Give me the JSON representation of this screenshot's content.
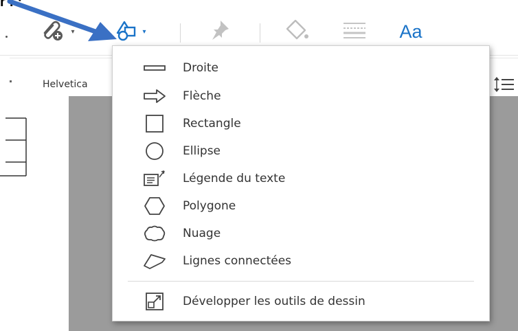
{
  "top_fragment": "r : :",
  "toolbar": {
    "items": [
      {
        "icon": "attach-add-icon"
      },
      {
        "icon": "shapes-icon"
      },
      {
        "icon": "pin-icon"
      },
      {
        "icon": "fill-bucket-icon"
      },
      {
        "icon": "line-weight-icon"
      },
      {
        "icon": "text-properties-icon",
        "label": "Aa"
      }
    ],
    "accent_color": "#1a73c8"
  },
  "properties": {
    "font_name": "Helvetica"
  },
  "menu": {
    "items": [
      {
        "label": "Droite",
        "icon": "line-icon"
      },
      {
        "label": "Flèche",
        "icon": "arrow-icon"
      },
      {
        "label": "Rectangle",
        "icon": "rectangle-icon"
      },
      {
        "label": "Ellipse",
        "icon": "ellipse-icon"
      },
      {
        "label": "Légende du texte",
        "icon": "text-callout-icon"
      },
      {
        "label": "Polygone",
        "icon": "polygon-icon"
      },
      {
        "label": "Nuage",
        "icon": "cloud-icon"
      },
      {
        "label": "Lignes connectées",
        "icon": "connected-lines-icon"
      }
    ],
    "footer": {
      "label": "Développer les outils de dessin",
      "icon": "expand-drawing-tools-icon"
    }
  },
  "annotation_arrow_color": "#3a70c4"
}
